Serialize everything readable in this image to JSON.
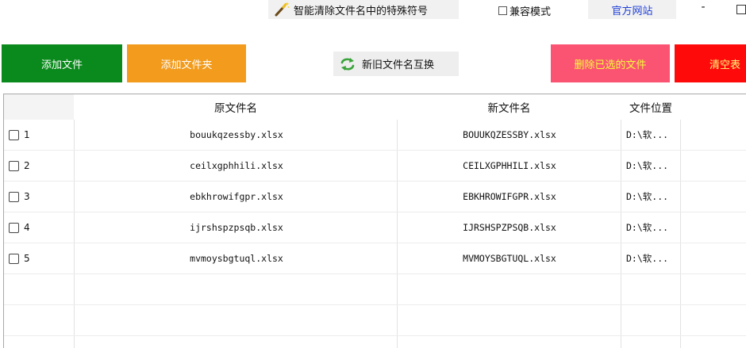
{
  "topbar": {
    "clean_special_label": "智能清除文件名中的特殊符号",
    "compat_mode_label": "兼容模式",
    "compat_mode_checked": false,
    "official_site_label": "官方网站",
    "minimize_label": "-"
  },
  "actions": {
    "add_file": "添加文件",
    "add_folder": "添加文件夹",
    "swap_names": "新旧文件名互换",
    "delete_selected": "删除已选的文件",
    "clear_table": "清空表"
  },
  "colors": {
    "add_file": "#0a8a1c",
    "add_folder": "#f29b1c",
    "delete_selected": "#fb5372",
    "clear_table": "#ff0a0a",
    "official_site_text": "#1f3fd6"
  },
  "table": {
    "headers": [
      "",
      "原文件名",
      "新文件名",
      "文件位置"
    ],
    "rows": [
      {
        "num": "1",
        "original": "bouukqzessby.xlsx",
        "new": "BOUUKQZESSBY.xlsx",
        "location": "D:\\软..."
      },
      {
        "num": "2",
        "original": "ceilxgphhili.xlsx",
        "new": "CEILXGPHHILI.xlsx",
        "location": "D:\\软..."
      },
      {
        "num": "3",
        "original": "ebkhrowifgpr.xlsx",
        "new": "EBKHROWIFGPR.xlsx",
        "location": "D:\\软..."
      },
      {
        "num": "4",
        "original": "ijrshspzpsqb.xlsx",
        "new": "IJRSHSPZPSQB.xlsx",
        "location": "D:\\软..."
      },
      {
        "num": "5",
        "original": "mvmoysbgtuql.xlsx",
        "new": "MVMOYSBGTUQL.xlsx",
        "location": "D:\\软..."
      }
    ]
  }
}
